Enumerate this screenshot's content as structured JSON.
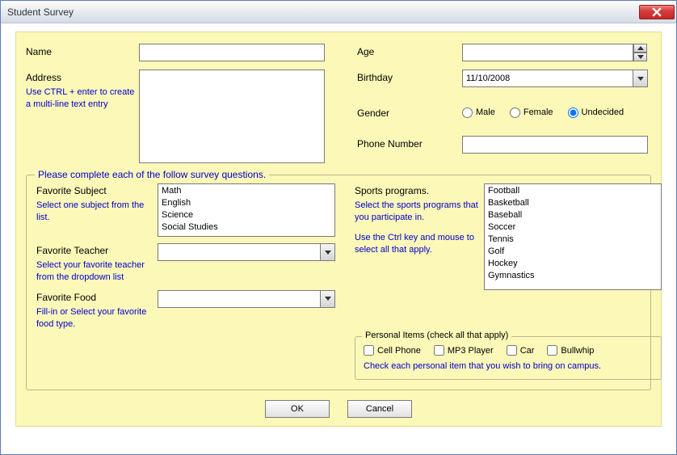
{
  "window": {
    "title": "Student Survey"
  },
  "top": {
    "name_label": "Name",
    "name_value": "",
    "address_label": "Address",
    "address_value": "",
    "address_hint": "Use CTRL + enter to create a multi-line text entry",
    "age_label": "Age",
    "age_value": "",
    "birthday_label": "Birthday",
    "birthday_value": "11/10/2008",
    "gender_label": "Gender",
    "gender_options": {
      "male": "Male",
      "female": "Female",
      "undecided": "Undecided"
    },
    "gender_selected": "undecided",
    "phone_label": "Phone Number",
    "phone_value": ""
  },
  "survey": {
    "legend": "Please complete each of the follow survey questions.",
    "fav_subject_label": "Favorite Subject",
    "fav_subject_hint": "Select one subject from the list.",
    "subjects": [
      "Math",
      "English",
      "Science",
      "Social Studies"
    ],
    "fav_teacher_label": "Favorite Teacher",
    "fav_teacher_hint": "Select your favorite teacher from the dropdown list",
    "fav_teacher_value": "",
    "fav_food_label": "Favorite Food",
    "fav_food_hint": "Fill-in or Select your favorite food type.",
    "fav_food_value": "",
    "sports_label": "Sports programs.",
    "sports_hint1": "Select the sports programs that you participate in.",
    "sports_hint2": "Use the Ctrl key and mouse to select all that apply.",
    "sports": [
      "Football",
      "Basketball",
      "Baseball",
      "Soccer",
      "Tennis",
      "Golf",
      "Hockey",
      "Gymnastics"
    ],
    "personal_legend": "Personal Items (check all that apply)",
    "personal_items": {
      "cell": "Cell Phone",
      "mp3": "MP3 Player",
      "car": "Car",
      "bullwhip": "Bullwhip"
    },
    "personal_hint": "Check each personal item that you wish to bring on campus."
  },
  "buttons": {
    "ok": "OK",
    "cancel": "Cancel"
  }
}
